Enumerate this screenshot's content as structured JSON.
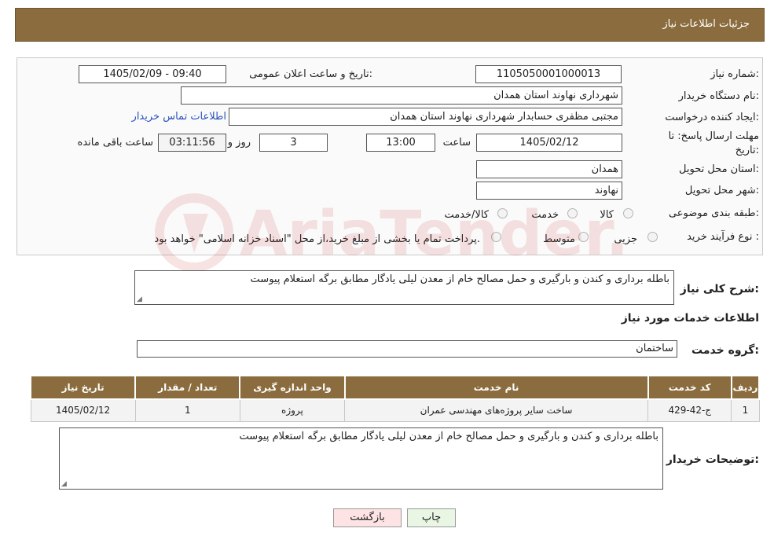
{
  "header": {
    "title": "جزئیات اطلاعات نیاز"
  },
  "fields": {
    "need_number_label": "شماره نیاز:",
    "need_number": "1105050001000013",
    "announce_label": "تاریخ و ساعت اعلان عمومی:",
    "announce_value": "1405/02/09 - 09:40",
    "buyer_org_label": "نام دستگاه خریدار:",
    "buyer_org": "شهرداری نهاوند استان همدان",
    "creator_label": "ایجاد کننده درخواست:",
    "creator": "مجتبی مظفری حسابدار شهرداری نهاوند استان همدان",
    "contact_link": "اطلاعات تماس خریدار",
    "deadline_label": "مهلت ارسال پاسخ: تا تاریخ:",
    "deadline_date": "1405/02/12",
    "time_label": "ساعت",
    "deadline_time": "13:00",
    "days_value": "3",
    "days_label": "روز و",
    "remaining_time": "03:11:56",
    "remaining_label": "ساعت باقی مانده",
    "province_label": "استان محل تحویل:",
    "province": "همدان",
    "city_label": "شهر محل تحویل:",
    "city": "نهاوند",
    "category_label": "طبقه بندی موضوعی:",
    "category_options": [
      "کالا",
      "خدمت",
      "کالا/خدمت"
    ],
    "process_label": "نوع فرآیند خرید :",
    "process_options": [
      "جزیی",
      "متوسط"
    ],
    "process_note": "پرداخت تمام یا بخشی از مبلغ خرید،از محل \"اسناد خزانه اسلامی\" خواهد بود."
  },
  "summary": {
    "label": "شرح کلی نیاز:",
    "text": "باطله برداری و کندن و بارگیری و حمل مصالح خام از معدن لیلی یادگار مطابق برگه استعلام پیوست"
  },
  "services": {
    "section_title": "اطلاعات خدمات مورد نیاز",
    "group_label": "گروه خدمت:",
    "group_value": "ساختمان",
    "table": {
      "headers": [
        "ردیف",
        "کد خدمت",
        "نام خدمت",
        "واحد اندازه گیری",
        "تعداد / مقدار",
        "تاریخ نیاز"
      ],
      "rows": [
        [
          "1",
          "ج-42-429",
          "ساخت سایر پروژه‌های مهندسی عمران",
          "پروژه",
          "1",
          "1405/02/12"
        ]
      ]
    }
  },
  "buyer_notes": {
    "label": "توضیحات خریدار:",
    "text": "باطله برداری و کندن و بارگیری و حمل مصالح خام از معدن لیلی یادگار مطابق برگه استعلام پیوست"
  },
  "buttons": {
    "print": "چاپ",
    "back": "بازگشت"
  },
  "watermark": {
    "text": "AriaTender.neT"
  },
  "colors": {
    "header": "#8a6c3e",
    "link": "#2a52be",
    "back_button": "#fde3e3",
    "print_button": "#e8f6e3"
  }
}
